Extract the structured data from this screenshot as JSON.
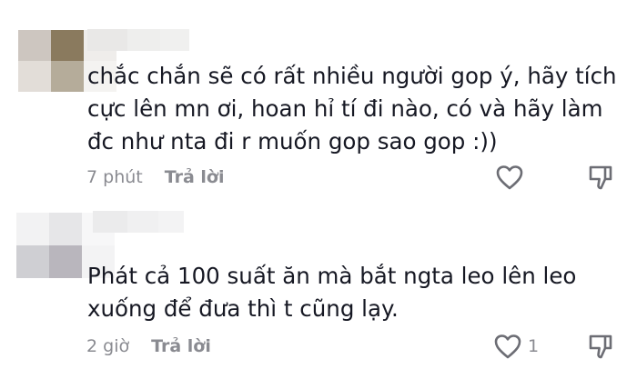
{
  "colors": {
    "text": "#161823",
    "muted": "#8a8b91",
    "icon": "#6c6d74",
    "background": "#ffffff"
  },
  "comments": [
    {
      "avatar_icon": "blurred-avatar-icon",
      "text": "chắc chắn sẽ có rất nhiều người gop ý, hãy tích cực lên mn ơi, hoan hỉ tí đi nào, có và hãy làm đc như nta đi r muốn gop sao gop :))",
      "time": "7 phút",
      "reply_label": "Trả lời",
      "like_count": ""
    },
    {
      "avatar_icon": "blurred-avatar-icon",
      "text": "Phát cả 100 suất ăn mà bắt ngta leo lên leo xuống để đưa thì t cũng lạy.",
      "time": "2 giờ",
      "reply_label": "Trả lời",
      "like_count": "1"
    }
  ]
}
